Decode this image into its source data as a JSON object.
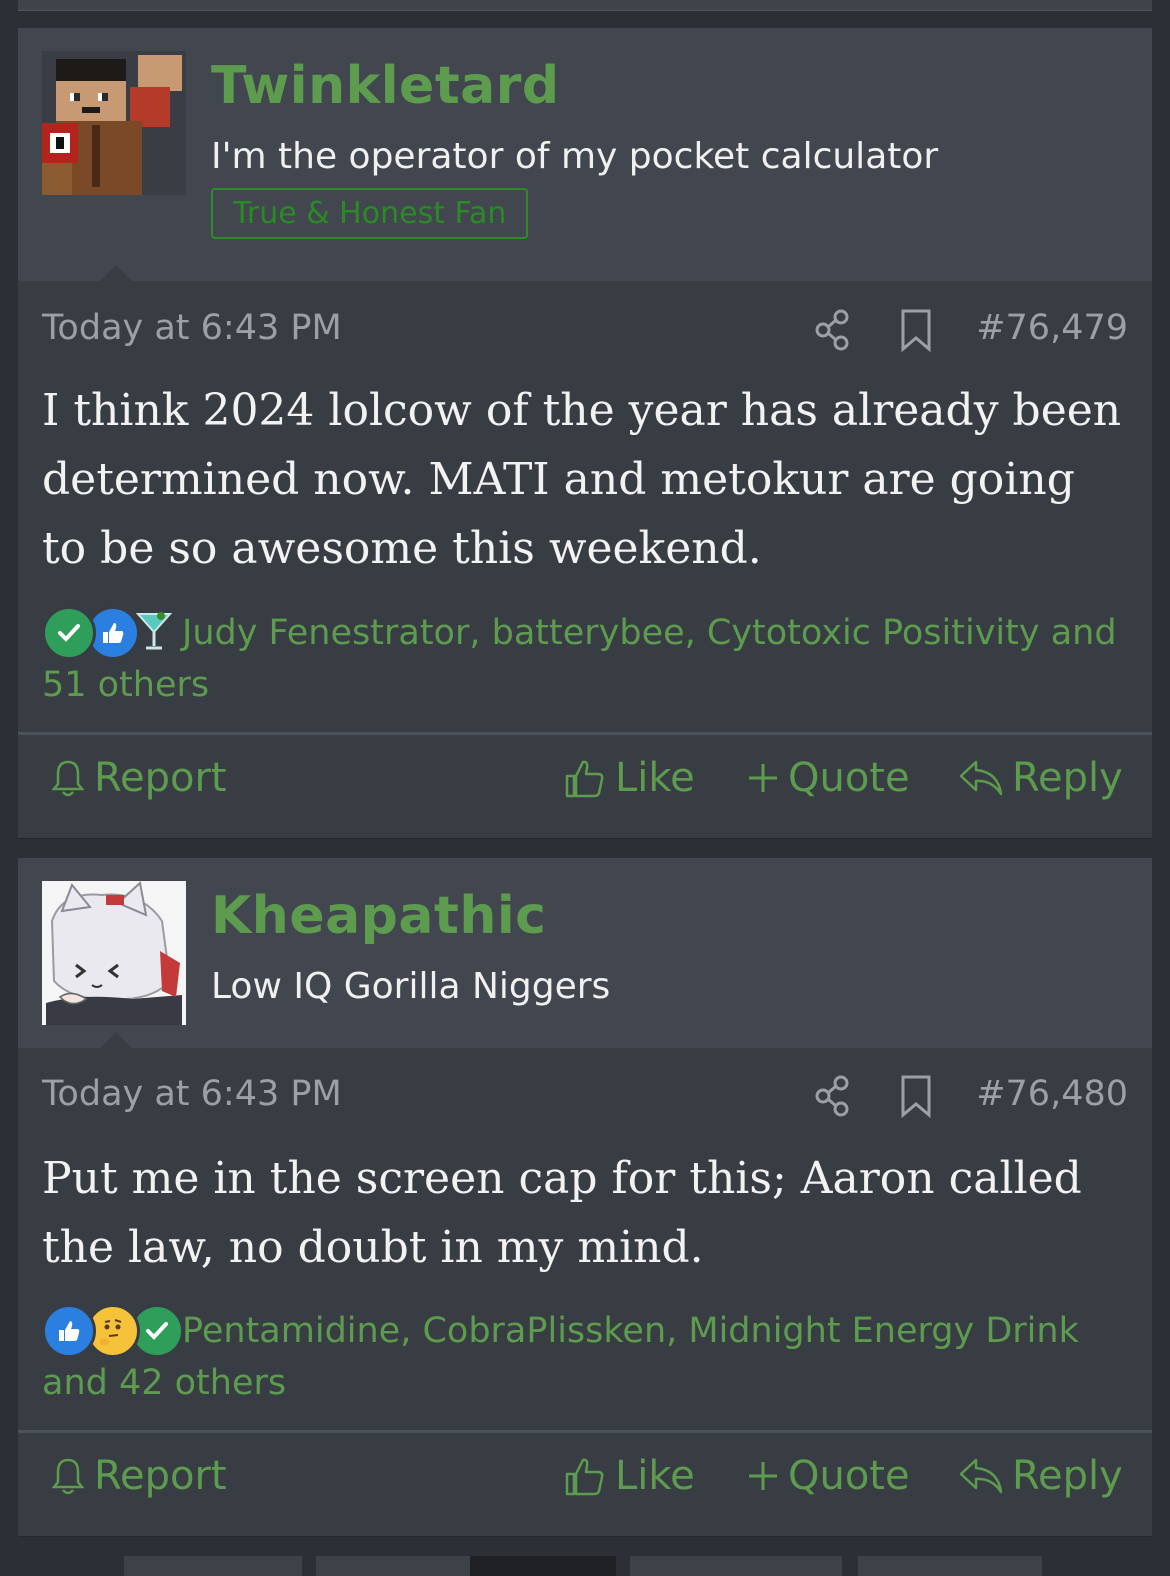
{
  "posts": [
    {
      "username": "Twinkletard",
      "user_title": "I'm the operator of my pocket calculator",
      "banner": "True & Honest Fan",
      "date": "Today at 6:43 PM",
      "post_number": "#76,479",
      "body": "I think 2024 lolcow of the year has already been determined now. MATI and metokur are going to be so awesome this weekend.",
      "reactions_text": "Judy Fenestrator, batterybee, Cytotoxic Positivity and 51 others",
      "reaction_icons": [
        "check-icon",
        "thumbs-up-icon",
        "cocktail-icon"
      ]
    },
    {
      "username": "Kheapathic",
      "user_title": "Low IQ Gorilla Niggers",
      "banner": "",
      "date": "Today at 6:43 PM",
      "post_number": "#76,480",
      "body": "Put me in the screen cap for this; Aaron called the law, no doubt in my mind.",
      "reactions_text": "Pentamidine, CobraPlissken, Midnight Energy Drink and 42 others",
      "reaction_icons": [
        "thumbs-up-icon",
        "thinking-face-icon",
        "check-icon"
      ]
    }
  ],
  "actions": {
    "report": "Report",
    "like": "Like",
    "quote": "Quote",
    "reply": "Reply"
  },
  "colors": {
    "accent_green": "#5d9b4f",
    "banner_green": "#2a8a25",
    "background": "#2c2f35",
    "post_body": "#383c43",
    "post_header": "#42464e"
  }
}
